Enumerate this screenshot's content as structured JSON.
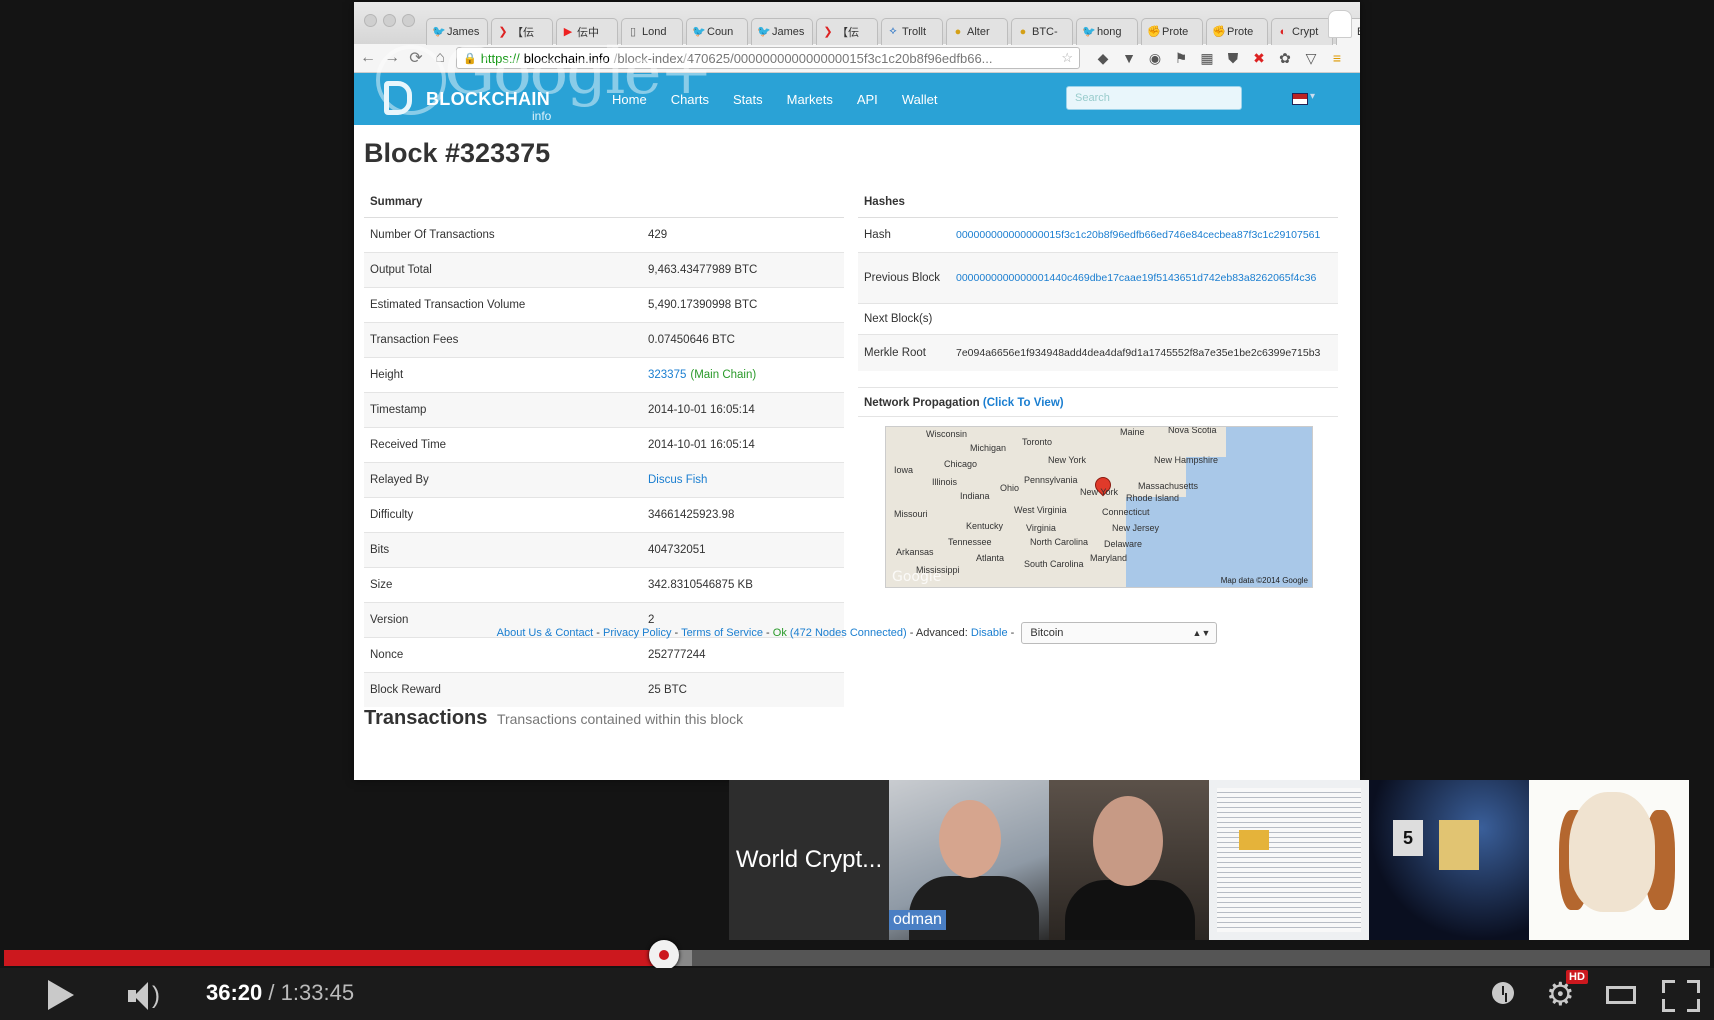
{
  "browser": {
    "tabs": [
      {
        "icon": "twitter-icon",
        "label": "James",
        "cls": "ic-tw",
        "glyph": "🐦"
      },
      {
        "icon": "red-icon",
        "label": "【伝"
      },
      {
        "icon": "youtube-icon",
        "label": "伝中"
      },
      {
        "icon": "page-icon",
        "label": "Lond"
      },
      {
        "icon": "twitter-icon",
        "label": "Coun"
      },
      {
        "icon": "twitter-icon",
        "label": "James"
      },
      {
        "icon": "red-icon",
        "label": "【伝"
      },
      {
        "icon": "trollbox-icon",
        "label": "Trollt"
      },
      {
        "icon": "altcoin-icon",
        "label": "Alter"
      },
      {
        "icon": "bitcoin-icon",
        "label": "BTC-"
      },
      {
        "icon": "twitter-icon",
        "label": "hong"
      },
      {
        "icon": "protest-icon",
        "label": "Prote"
      },
      {
        "icon": "protest-icon",
        "label": "Prote"
      },
      {
        "icon": "crypto-icon",
        "label": "Crypt"
      },
      {
        "icon": "blockchain-icon",
        "label": "Bl",
        "active": true
      }
    ],
    "url": {
      "scheme": "https://",
      "host": "blockchain.info",
      "path": "/block-index/470625/000000000000000015f3c1c20b8f96edfb66..."
    }
  },
  "site": {
    "logo_text": "BLOCKCHAIN",
    "logo_sub": "info",
    "nav": [
      "Home",
      "Charts",
      "Stats",
      "Markets",
      "API",
      "Wallet"
    ],
    "search_placeholder": "Search",
    "watermark": "Google+"
  },
  "block": {
    "title": "Block #323375",
    "summary_header": "Summary",
    "summary": [
      {
        "k": "Number Of Transactions",
        "v": "429"
      },
      {
        "k": "Output Total",
        "v": "9,463.43477989 BTC"
      },
      {
        "k": "Estimated Transaction Volume",
        "v": "5,490.17390998 BTC"
      },
      {
        "k": "Transaction Fees",
        "v": "0.07450646 BTC"
      },
      {
        "k": "Height",
        "v": "323375",
        "v2": "(Main Chain)"
      },
      {
        "k": "Timestamp",
        "v": "2014-10-01 16:05:14"
      },
      {
        "k": "Received Time",
        "v": "2014-10-01 16:05:14"
      },
      {
        "k": "Relayed By",
        "v": "Discus Fish"
      },
      {
        "k": "Difficulty",
        "v": "34661425923.98"
      },
      {
        "k": "Bits",
        "v": "404732051"
      },
      {
        "k": "Size",
        "v": "342.8310546875 KB"
      },
      {
        "k": "Version",
        "v": "2"
      },
      {
        "k": "Nonce",
        "v": "252777244"
      },
      {
        "k": "Block Reward",
        "v": "25 BTC"
      }
    ],
    "hashes_header": "Hashes",
    "hashes": [
      {
        "k": "Hash",
        "v": "000000000000000015f3c1c20b8f96edfb66ed746e84cecbea87f3c1c29107561"
      },
      {
        "k": "Previous Block",
        "v": "0000000000000001440c469dbe17caae19f5143651d742eb83a8262065f4c36"
      },
      {
        "k": "Next Block(s)",
        "v": ""
      },
      {
        "k": "Merkle Root",
        "v": "7e094a6656e1f934948add4dea4daf9d1a1745552f8a7e35e1be2c6399e715b3"
      }
    ],
    "network_propagation": "Network Propagation",
    "click_to_view": "(Click To View)",
    "map_credit": "Map data ©2014 Google",
    "map_google": "Google",
    "map_labels": [
      "Wisconsin",
      "Michigan",
      "Toronto",
      "Maine",
      "Nova Scotia",
      "Iowa",
      "Chicago",
      "Illinois",
      "New York",
      "New Hampshire",
      "Pennsylvania",
      "Massachusetts",
      "Ohio",
      "Indiana",
      "New York",
      "Rhode Island",
      "Connecticut",
      "Missouri",
      "West Virginia",
      "Virginia",
      "New Jersey",
      "Kentucky",
      "Tennessee",
      "North Carolina",
      "Delaware",
      "Arkansas",
      "Maryland",
      "Atlanta",
      "South Carolina",
      "Mississippi"
    ],
    "transactions_title": "Transactions",
    "transactions_sub": "Transactions contained within this block"
  },
  "footer": {
    "about": "About Us & Contact",
    "privacy": "Privacy Policy",
    "terms": "Terms of Service",
    "ok": "Ok",
    "nodes": "(472 Nodes Connected)",
    "advanced": "Advanced:",
    "disable": "Disable",
    "select_value": "Bitcoin"
  },
  "hangout": {
    "title_tile": "World Crypt...",
    "name_label": "odman"
  },
  "player": {
    "current_time": "36:20",
    "separator": "/",
    "duration": "1:33:45",
    "played_fraction": 0.387,
    "loaded_fraction": 0.403,
    "hd": "HD"
  }
}
